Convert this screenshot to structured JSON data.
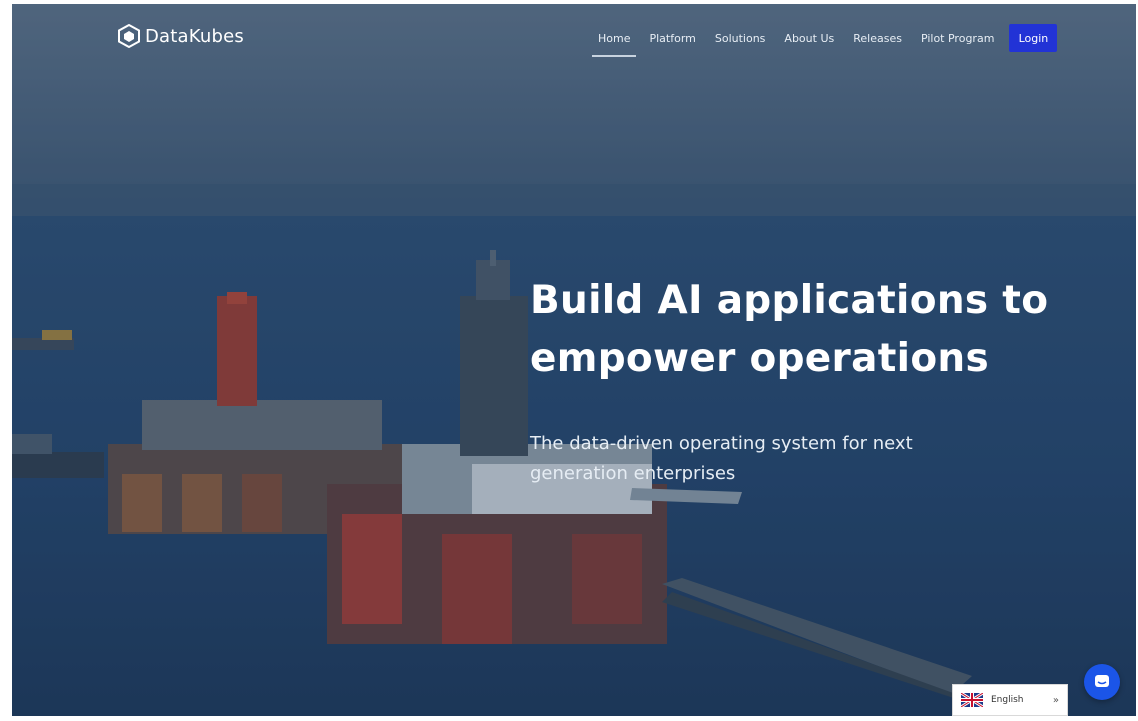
{
  "brand": {
    "name": "DataKubes",
    "icon": "hexagon-logo-icon"
  },
  "nav": {
    "items": [
      {
        "label": "Home",
        "active": true
      },
      {
        "label": "Platform",
        "active": false
      },
      {
        "label": "Solutions",
        "active": false
      },
      {
        "label": "About Us",
        "active": false
      },
      {
        "label": "Releases",
        "active": false
      },
      {
        "label": "Pilot Program",
        "active": false
      }
    ],
    "login_label": "Login"
  },
  "hero": {
    "title_line1": "Build AI applications to",
    "title_line2": "empower operations",
    "subtitle_line1": "The data-driven operating system for next",
    "subtitle_line2": "generation enterprises"
  },
  "language": {
    "selected": "English",
    "icon": "uk-flag-icon",
    "caret": "»"
  },
  "chat": {
    "icon": "chat-bubble-icon"
  },
  "colors": {
    "accent": "#2233d6",
    "chat": "#1b55e8",
    "overlay": "#1f3a5c"
  }
}
